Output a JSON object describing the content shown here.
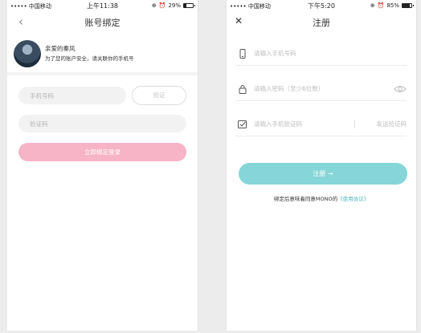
{
  "left": {
    "status": {
      "carrier": "••••• 中国移动",
      "time": "上午11:38",
      "battery": "29%",
      "battery_level": 0.29
    },
    "title": "账号绑定",
    "back_icon": "chevron-left-icon",
    "profile": {
      "name": "亲爱的秦风",
      "desc": "为了您的账户安全，请关联你的手机号"
    },
    "phone_placeholder": "手机号码",
    "verify_label": "验证",
    "code_placeholder": "验证码",
    "bind_label": "立即绑定登录",
    "colors": {
      "bind_button": "#f7b4c7"
    }
  },
  "right": {
    "status": {
      "carrier": "••••• 中国移动",
      "time": "下午5:20",
      "battery": "85%",
      "battery_level": 0.85
    },
    "title": "注册",
    "close_icon": "close-icon",
    "phone_placeholder": "请输入手机号码",
    "password_placeholder": "请输入密码（至少6位数）",
    "sms_placeholder": "请输入手机验证码",
    "send_code_label": "发送验证码",
    "register_label": "注册 →",
    "agree_prefix": "绑定后意味着同意MONO的",
    "agree_link": "《使用协议》",
    "colors": {
      "register_button": "#86d5d8",
      "link": "#4fb7bd"
    }
  }
}
